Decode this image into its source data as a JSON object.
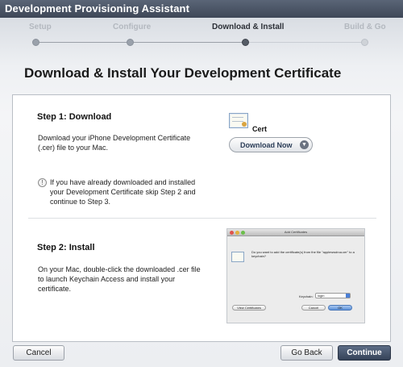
{
  "window": {
    "title": "Development Provisioning Assistant"
  },
  "steps": [
    {
      "label": "Setup",
      "state": "done"
    },
    {
      "label": "Configure",
      "state": "done"
    },
    {
      "label": "Download & Install",
      "state": "active"
    },
    {
      "label": "Build & Go",
      "state": "pending"
    }
  ],
  "page": {
    "title": "Download & Install Your Development Certificate"
  },
  "step1": {
    "heading": "Step 1: Download",
    "text": "Download your iPhone Development Certificate (.cer) file to your Mac.",
    "note": "If you have already downloaded and installed your Development Certificate skip Step 2 and continue to Step 3.",
    "note_icon": "!",
    "cert_label": "Cert",
    "download_button": "Download Now"
  },
  "step2": {
    "heading": "Step 2: Install",
    "text": "On your Mac, double-click the downloaded .cer file to launch Keychain Access and install your certificate."
  },
  "keychain_dialog": {
    "title": "Add Certificates",
    "message": "Do you want to add the certificate(s) from the file \"applewwdrca.cer\" to a keychain?",
    "keychain_label": "Keychain:",
    "keychain_value": "login",
    "view_button": "View Certificates",
    "cancel_button": "Cancel",
    "ok_button": "OK"
  },
  "footer": {
    "cancel": "Cancel",
    "go_back": "Go Back",
    "continue": "Continue"
  }
}
